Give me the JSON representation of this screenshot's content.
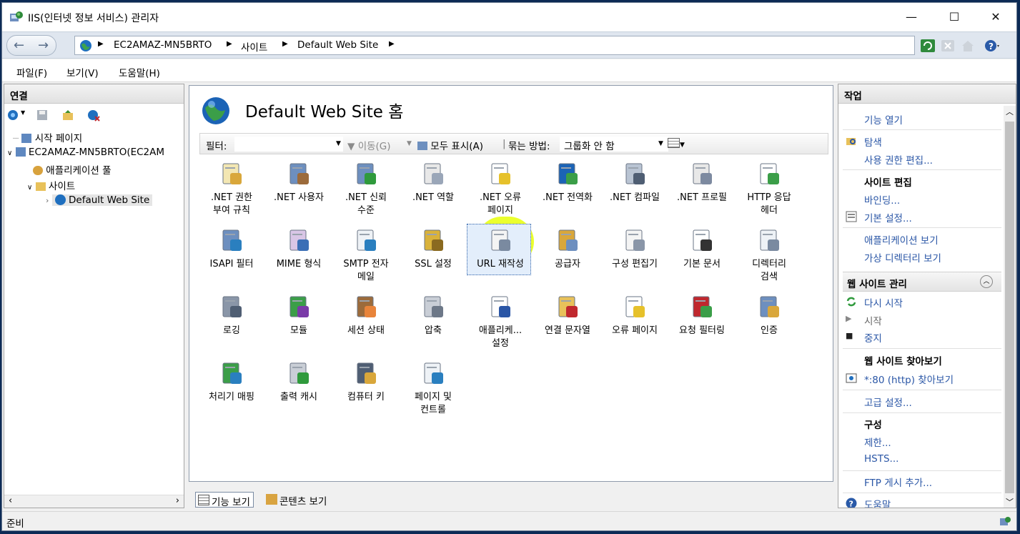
{
  "window": {
    "title": "IIS(인터넷 정보 서비스) 관리자",
    "minimize_glyph": "—",
    "maximize_glyph": "☐",
    "close_glyph": "✕"
  },
  "breadcrumb": {
    "items": [
      "EC2AMAZ-MN5BRTO",
      "사이트",
      "Default Web Site"
    ]
  },
  "menu": {
    "items": [
      "파일(F)",
      "보기(V)",
      "도움말(H)"
    ]
  },
  "connections": {
    "header": "연결",
    "tree": {
      "start_page": "시작 페이지",
      "server": "EC2AMAZ-MN5BRTO(EC2AM",
      "app_pools": "애플리케이션 풀",
      "sites": "사이트",
      "default_site": "Default Web Site"
    }
  },
  "center": {
    "title": "Default Web Site 홈",
    "filter": {
      "label": "필터:",
      "go": "이동(G)",
      "show_all": "모두 표시(A)",
      "group_by": "묶는 방법:",
      "group_value": "그룹화 안 함"
    },
    "features": [
      [
        ".NET 권한",
        "부여 규칙"
      ],
      [
        ".NET 사용자"
      ],
      [
        ".NET 신뢰",
        "수준"
      ],
      [
        ".NET 역할"
      ],
      [
        ".NET 오류",
        "페이지"
      ],
      [
        ".NET 전역화"
      ],
      [
        ".NET 컴파일"
      ],
      [
        ".NET 프로필"
      ],
      [
        "HTTP 응답",
        "헤더"
      ],
      [
        "ISAPI 필터"
      ],
      [
        "MIME 형식"
      ],
      [
        "SMTP 전자",
        "메일"
      ],
      [
        "SSL 설정"
      ],
      [
        "URL 재작성"
      ],
      [
        "공급자"
      ],
      [
        "구성 편집기"
      ],
      [
        "기본 문서"
      ],
      [
        "디렉터리",
        "검색"
      ],
      [
        "로깅"
      ],
      [
        "모듈"
      ],
      [
        "세션 상태"
      ],
      [
        "압축"
      ],
      [
        "애플리케...",
        "설정"
      ],
      [
        "연결 문자열"
      ],
      [
        "오류 페이지"
      ],
      [
        "요청 필터링"
      ],
      [
        "인증"
      ],
      [
        "처리기 매핑"
      ],
      [
        "출력 캐시"
      ],
      [
        "컴퓨터 키"
      ],
      [
        "페이지 및",
        "컨트롤"
      ]
    ],
    "view_tabs": {
      "features_view": "기능 보기",
      "content_view": "콘텐츠 보기"
    }
  },
  "actions": {
    "header": "작업",
    "open_feature": "기능 열기",
    "explore": "탐색",
    "edit_permissions": "사용 권한 편집...",
    "edit_site_header": "사이트 편집",
    "bindings": "바인딩...",
    "basic_settings": "기본 설정...",
    "view_applications": "애플리케이션 보기",
    "view_virtual_dirs": "가상 디렉터리 보기",
    "manage_site_section": "웹 사이트 관리",
    "restart": "다시 시작",
    "start": "시작",
    "stop": "중지",
    "browse_header": "웹 사이트 찾아보기",
    "browse_80": "*:80 (http) 찾아보기",
    "advanced_settings": "고급 설정...",
    "config_header": "구성",
    "limits": "제한...",
    "hsts": "HSTS...",
    "add_ftp": "FTP 게시 추가...",
    "help": "도움말"
  },
  "status": {
    "text": "준비"
  },
  "colors": {
    "link": "#2a56a6",
    "highlight": "#e6ff00"
  }
}
